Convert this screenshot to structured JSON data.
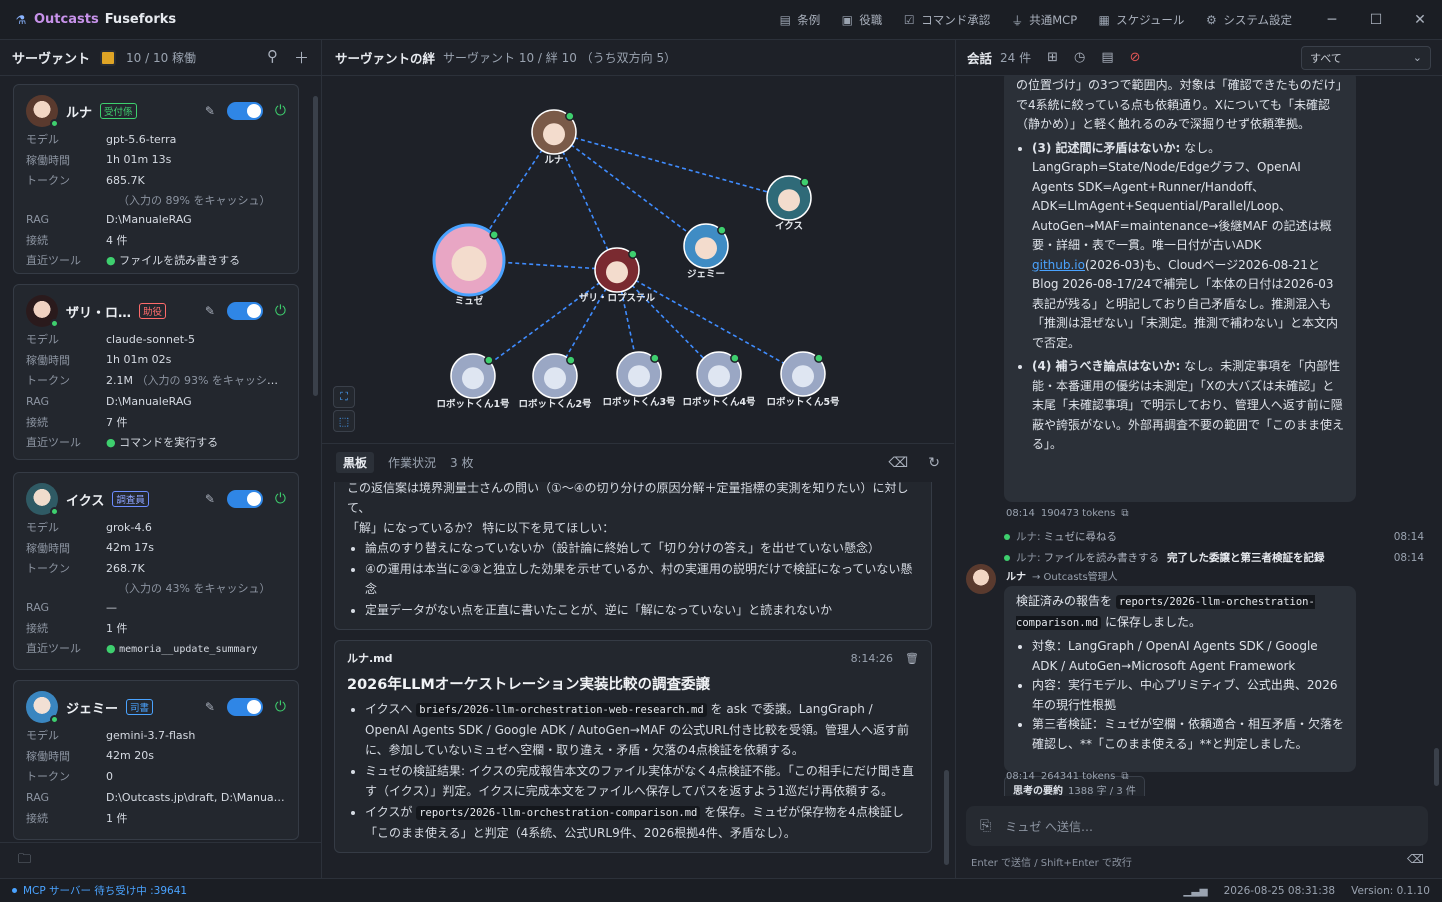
{
  "titlebar": {
    "brand_prefix": "Outcasts",
    "brand_name": "Fuseforks",
    "menu": [
      {
        "icon": "book-icon",
        "label": "条例"
      },
      {
        "icon": "briefcase-icon",
        "label": "役職"
      },
      {
        "icon": "checkbox-icon",
        "label": "コマンド承認"
      },
      {
        "icon": "plug-icon",
        "label": "共通MCP"
      },
      {
        "icon": "calendar-icon",
        "label": "スケジュール"
      },
      {
        "icon": "gear-icon",
        "label": "システム設定"
      }
    ]
  },
  "left": {
    "title": "サーヴァント",
    "count": "10 / 10 稼働",
    "labels": {
      "model": "モデル",
      "uptime": "稼働時間",
      "tokens": "トークン",
      "rag": "RAG",
      "conn": "接続",
      "tool": "直近ツール"
    },
    "servants": [
      {
        "name": "ルナ",
        "role": "受付係",
        "role_color": "#3ecf6e",
        "model": "gpt-5.6-terra",
        "uptime": "1h 01m 13s",
        "tokens": "685.7K",
        "cache": "（入力の 89% をキャッシュ）",
        "rag": "D:\\ManualeRAG",
        "conn": "4 件",
        "tool": "ファイルを読み書きする"
      },
      {
        "name": "ザリ・ロ…",
        "role": "助役",
        "role_color": "#ff6b6b",
        "model": "claude-sonnet-5",
        "uptime": "1h 01m 02s",
        "tokens": "2.1M",
        "cache": "（入力の 93% をキャッシュ）",
        "rag": "D:\\ManualeRAG",
        "conn": "7 件",
        "tool": "コマンドを実行する"
      },
      {
        "name": "イクス",
        "role": "調査員",
        "role_color": "#6c8cff",
        "model": "grok-4.6",
        "uptime": "42m 17s",
        "tokens": "268.7K",
        "cache": "（入力の 43% をキャッシュ）",
        "rag": "—",
        "conn": "1 件",
        "tool": "memoria__update_summary"
      },
      {
        "name": "ジェミー",
        "role": "司書",
        "role_color": "#4aa3ff",
        "model": "gemini-3.7-flash",
        "uptime": "42m 20s",
        "tokens": "0",
        "rag": "D:\\Outcasts.jp\\draft, D:\\Manuale…",
        "conn": "1 件"
      }
    ]
  },
  "middle": {
    "title": "サーヴァントの絆",
    "subtitle": "サーヴァント 10 / 絆 10 （うち双方向 5）",
    "nodes": [
      {
        "label": "ルナ",
        "fill": "#7a5a48"
      },
      {
        "label": "イクス",
        "fill": "#2f6a78"
      },
      {
        "label": "ジェミー",
        "fill": "#3f8cc4"
      },
      {
        "label": "ミュゼ",
        "fill": "#e8a6c4"
      },
      {
        "label": "ザリ・ロプステル",
        "fill": "#7a2a30"
      },
      {
        "label": "ロボットくん1号",
        "fill": "#9aa7c4"
      },
      {
        "label": "ロボットくん2号",
        "fill": "#9aa7c4"
      },
      {
        "label": "ロボットくん3号",
        "fill": "#9aa7c4"
      },
      {
        "label": "ロボットくん4号",
        "fill": "#9aa7c4"
      },
      {
        "label": "ロボットくん5号",
        "fill": "#9aa7c4"
      }
    ],
    "tabs": [
      "黒板",
      "作業状況",
      "3 枚"
    ],
    "board_top": {
      "intro": "この返信案は境界測量士さんの問い（①〜④の切り分けの原因分解＋定量指標の実測を知りたい）に対して、",
      "intro2": "「解」になっているか？ 特に以下を見てほしい：",
      "items": [
        "論点のすり替えになっていないか（設計論に終始して「切り分けの答え」を出せていない懸念）",
        "④の運用は本当に②③と独立した効果を示せているか、村の実運用の説明だけで検証になっていない懸念",
        "定量データがない点を正直に書いたことが、逆に「解になっていない」と読まれないか"
      ]
    },
    "board_card": {
      "file": "ルナ.md",
      "time": "8:14:26",
      "heading": "2026年LLMオーケストレーション実装比較の調査委譲",
      "i1a": "イクスへ",
      "i1code": "briefs/2026-llm-orchestration-web-research.md",
      "i1b": "を ask で委譲。LangGraph / OpenAI Agents SDK / Google ADK / AutoGen→MAF の公式URL付き比較を受領。管理人へ返す前に、参加していないミュゼへ空欄・取り違え・矛盾・欠落の4点検証を依頼する。",
      "i2": "ミュゼの検証結果: イクスの完成報告本文のファイル実体がなく4点検証不能。「この相手にだけ聞き直す（イクス）」判定。イクスに完成本文をファイルへ保存してパスを返すよう1巡だけ再依頼する。",
      "i3a": "イクスが",
      "i3code": "reports/2026-llm-orchestration-comparison.md",
      "i3b": "を保存。ミュゼが保存物を4点検証し「このまま使える」と判定（4系統、公式URL9件、2026根拠4件、矛盾なし）。"
    }
  },
  "right": {
    "title": "会話",
    "count": "24 件",
    "filter": "すべて",
    "b1_top": "の位置づけ」の3つで範囲内。対象は「確認できたものだけ」で4系統に絞っている点も依頼通り。Xについても「未確認（静かめ）」と軽く触れるのみで深掘りせず依頼準拠。",
    "b1_items": [
      {
        "head": "(3) 記述間に矛盾はないか:",
        "body": "なし。LangGraph=State/Node/Edgeグラフ、OpenAI Agents SDK=Agent+Runner/Handoff、ADK=LlmAgent+Sequential/Parallel/Loop、AutoGen→MAF=maintenance→後継MAF の記述は概要・詳細・表で一貫。唯一日付が古いADK ",
        "link": "github.io",
        "tail": "(2026-03)も、Cloudページ2026-08-21とBlog 2026-08-17/24で補完し「本体の日付は2026-03表記が残る」と明記しており自己矛盾なし。推測混入も「推測は混ぜない」「未測定。推測で補わない」と本文内で否定。"
      },
      {
        "head": "(4) 補うべき論点はないか:",
        "body": "なし。未測定事項を「内部性能・本番運用の優劣は未測定」「Xの大バズは未確認」と末尾「未確認事項」で明示しており、管理人へ返す前に隠蔽や誇張がない。外部再調査不要の範囲で「このまま使える」。",
        "link": "",
        "tail": ""
      }
    ],
    "b1_meta": {
      "time": "08:14",
      "tokens": "190473 tokens"
    },
    "logs": [
      {
        "who": "ルナ:",
        "text": "ミュゼに尋ねる",
        "bold": "",
        "time": "08:14"
      },
      {
        "who": "ルナ:",
        "text": "ファイルを読み書きする",
        "bold": "完了した委譲と第三者検証を記録",
        "time": "08:14"
      }
    ],
    "b2_from": "ルナ",
    "b2_to": "→ Outcasts管理人",
    "b2_text1": "検証済みの報告を",
    "b2_code": "reports/2026-llm-orchestration-comparison.md",
    "b2_text2": "に保存しました。",
    "b2_items": [
      "対象：LangGraph / OpenAI Agents SDK / Google ADK / AutoGen→Microsoft Agent Framework",
      "内容：実行モデル、中心プリミティブ、公式出典、2026年の現行性根拠",
      "第三者検証：ミュゼが空欄・依頼適合・相互矛盾・欠落を確認し、**「このまま使える」**と判定しました。"
    ],
    "summary_label": "思考の要約",
    "summary_meta": "1388 字 / 3 件",
    "b2_meta": {
      "time": "08:14",
      "tokens": "264341 tokens"
    },
    "input_placeholder": "ミュゼ へ送信…",
    "hint": "Enter で送信 / Shift+Enter で改行"
  },
  "status": {
    "mcp": "MCP サーバー 待ち受け中 :39641",
    "datetime": "2026-08-25 08:31:38",
    "version": "Version: 0.1.10"
  }
}
